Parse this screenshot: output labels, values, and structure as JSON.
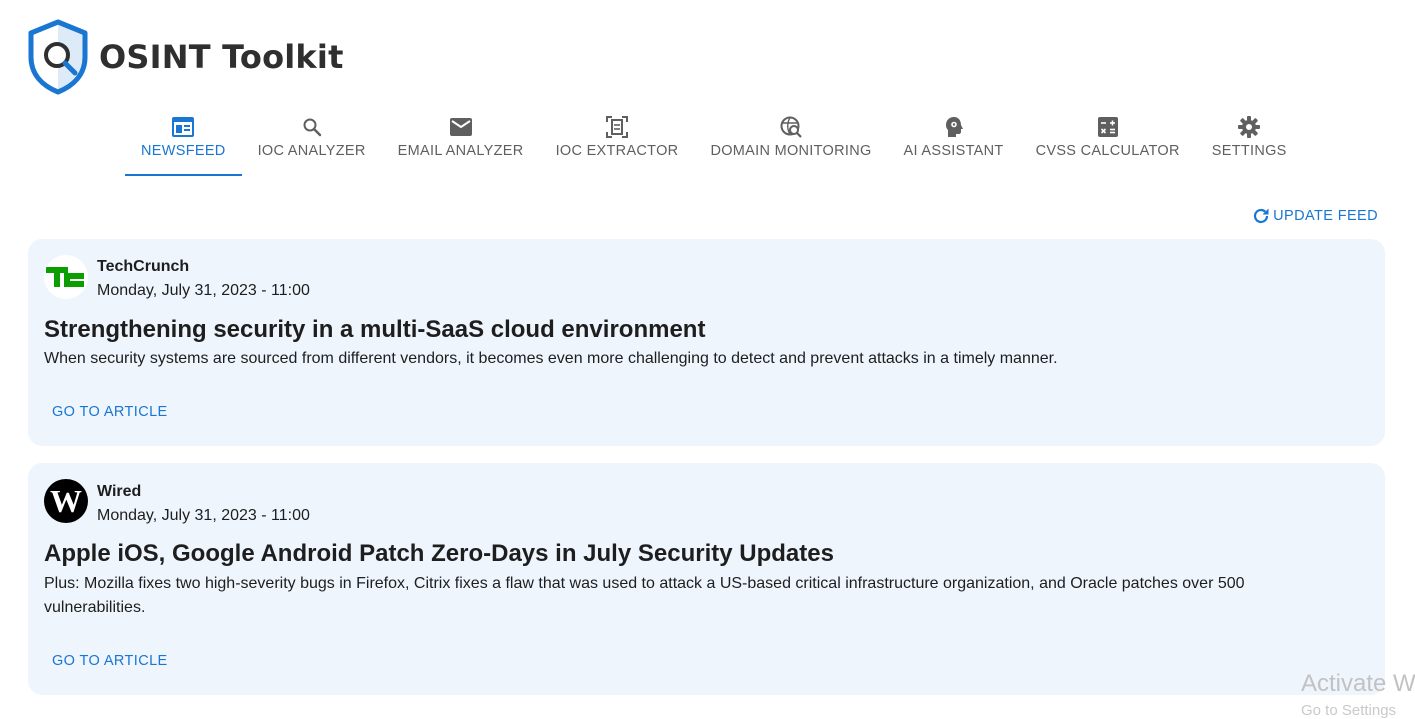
{
  "app": {
    "title": "OSINT Toolkit"
  },
  "tabs": [
    {
      "label": "NEWSFEED",
      "icon": "newspaper-icon",
      "active": true
    },
    {
      "label": "IOC ANALYZER",
      "icon": "search-icon"
    },
    {
      "label": "EMAIL ANALYZER",
      "icon": "mail-icon"
    },
    {
      "label": "IOC EXTRACTOR",
      "icon": "document-scan-icon"
    },
    {
      "label": "DOMAIN MONITORING",
      "icon": "globe-search-icon"
    },
    {
      "label": "AI ASSISTANT",
      "icon": "brain-head-icon"
    },
    {
      "label": "CVSS CALCULATOR",
      "icon": "calculator-icon"
    },
    {
      "label": "SETTINGS",
      "icon": "gear-icon"
    }
  ],
  "actions": {
    "update_feed": "UPDATE FEED"
  },
  "articles": [
    {
      "source": "TechCrunch",
      "logo_text": "TC",
      "date": "Monday, July 31, 2023 - 11:00",
      "title": "Strengthening security in a multi-SaaS cloud environment",
      "description": "When security systems are sourced from different vendors, it becomes even more challenging to detect and prevent attacks in a timely manner.",
      "link_label": "GO TO ARTICLE"
    },
    {
      "source": "Wired",
      "logo_text": "W",
      "date": "Monday, July 31, 2023 - 11:00",
      "title": "Apple iOS, Google Android Patch Zero-Days in July Security Updates",
      "description": "Plus: Mozilla fixes two high-severity bugs in Firefox, Citrix fixes a flaw that was used to attack a US-based critical infrastructure organization, and Oracle patches over 500 vulnerabilities.",
      "link_label": "GO TO ARTICLE"
    }
  ],
  "watermark": {
    "line1": "Activate W",
    "line2": "Go to Settings"
  },
  "colors": {
    "accent": "#1976d2",
    "card_bg": "#eef5fd",
    "techcrunch_green": "#0a9e01"
  }
}
